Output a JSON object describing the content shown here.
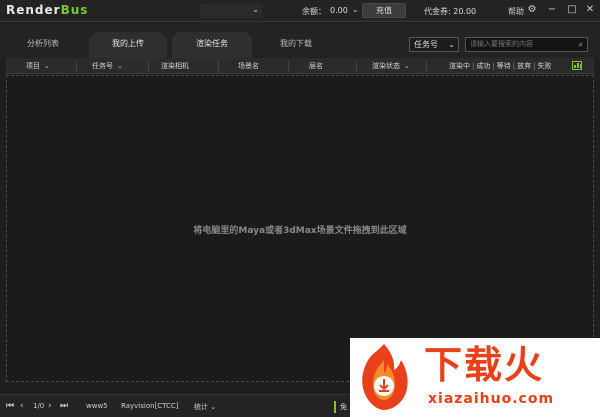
{
  "app": {
    "logo_part1": "Render",
    "logo_part2": "Bus"
  },
  "titlebar": {
    "balance_label": "余额：",
    "balance_value": "0.00",
    "recharge_label": "充值",
    "coupon_label": "代金券: 20.00",
    "help_label": "帮助"
  },
  "tabs": [
    {
      "label": "分析列表",
      "active": false
    },
    {
      "label": "我的上传",
      "active": true
    },
    {
      "label": "渲染任务",
      "active": true
    },
    {
      "label": "我的下载",
      "active": false
    }
  ],
  "filter": {
    "selected": "任务号"
  },
  "search": {
    "placeholder": "请输入要搜索的内容"
  },
  "columns": [
    "项目",
    "任务号",
    "渲染相机",
    "场景名",
    "层名",
    "渲染状态"
  ],
  "status_filters": [
    "渲染中",
    "成功",
    "等待",
    "放弃",
    "失败"
  ],
  "droparea": {
    "hint": "将电脑里的Maya或者3dMax场景文件拖拽到此区域"
  },
  "bottombar": {
    "page_info": "1/0",
    "platform": "www5",
    "server": "Rayvision[CTCC]",
    "stats_label": "统计",
    "free_label": "免"
  },
  "watermark": {
    "title": "下载火",
    "url": "xiazaihuo.com"
  },
  "colors": {
    "accent": "#78c82e",
    "watermark": "#e8401a"
  }
}
